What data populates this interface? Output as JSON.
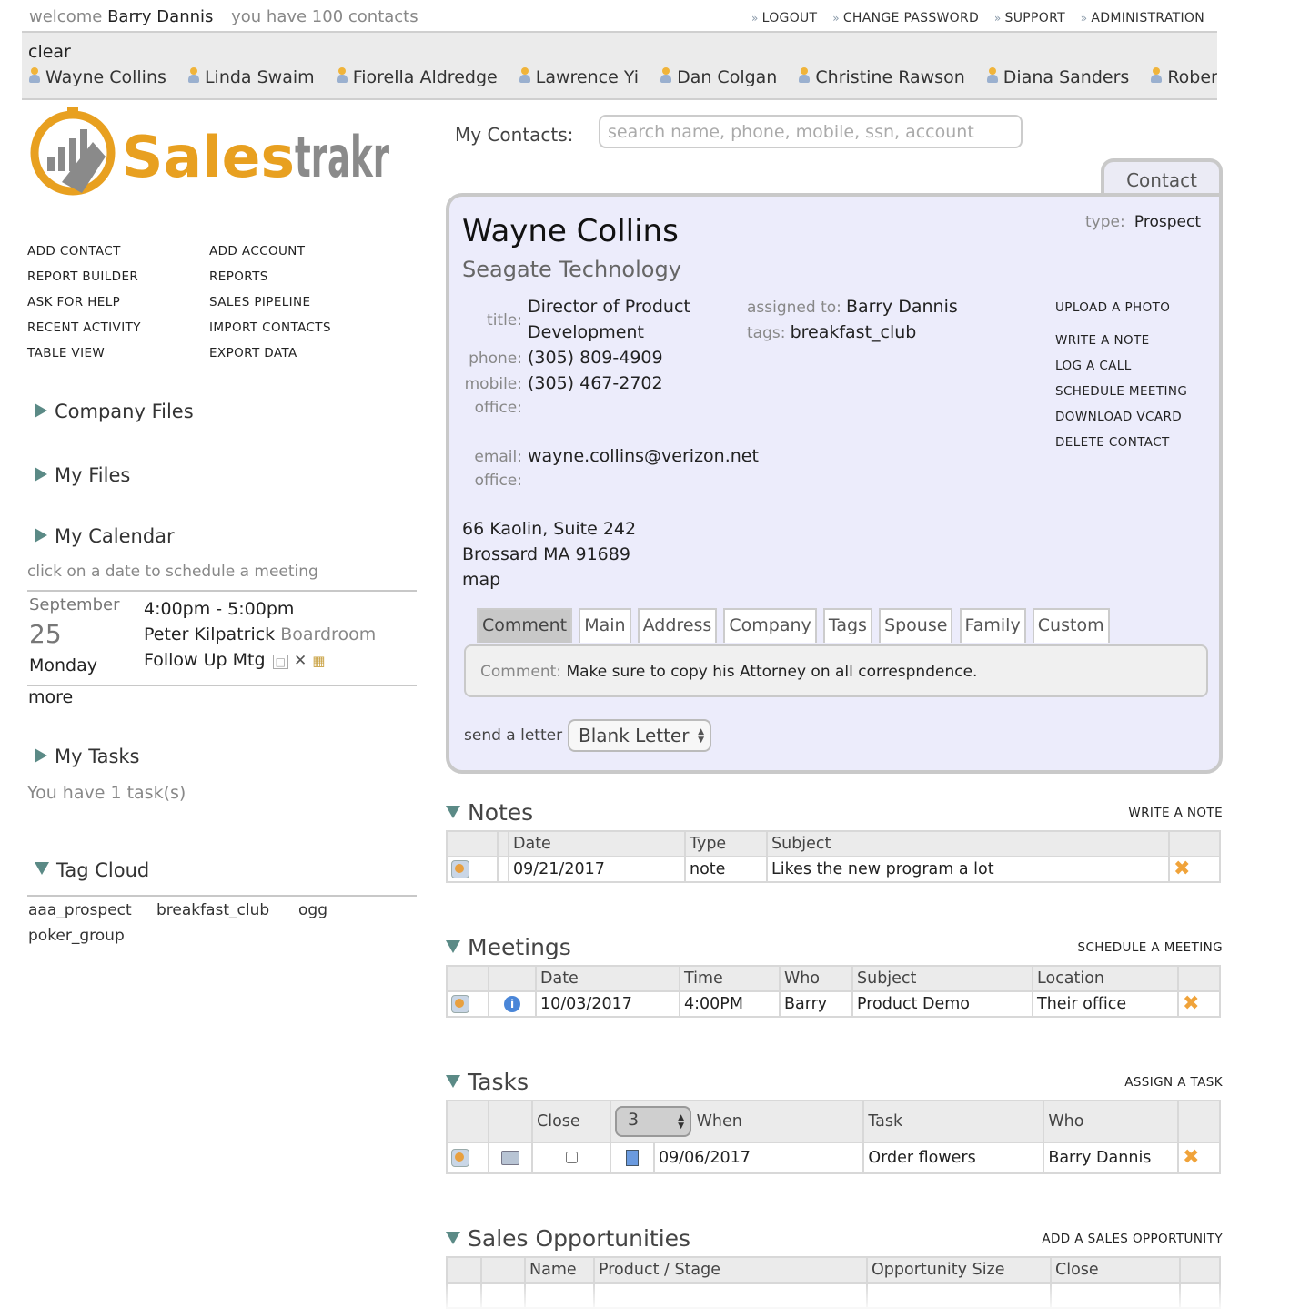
{
  "header": {
    "welcome_prefix": "welcome",
    "user": "Barry Dannis",
    "contacts_text": "you have 100 contacts",
    "links": [
      "LOGOUT",
      "CHANGE PASSWORD",
      "SUPPORT",
      "ADMINISTRATION"
    ]
  },
  "recent": {
    "clear": "clear",
    "people": [
      "Wayne Collins",
      "Linda Swaim",
      "Fiorella Aldredge",
      "Lawrence Yi",
      "Dan Colgan",
      "Christine Rawson",
      "Diana Sanders",
      "Robert"
    ]
  },
  "logo": {
    "text": "Salestrakr",
    "color": "#e8a020"
  },
  "menu": {
    "left": [
      "ADD CONTACT",
      "REPORT BUILDER",
      "ASK FOR HELP",
      "RECENT ACTIVITY",
      "TABLE VIEW"
    ],
    "right": [
      "ADD ACCOUNT",
      "REPORTS",
      "SALES PIPELINE",
      "IMPORT CONTACTS",
      "EXPORT DATA"
    ]
  },
  "sidebar": {
    "company_files": "Company Files",
    "my_files": "My Files",
    "my_calendar": "My Calendar",
    "calendar_hint": "click on a date to schedule a meeting",
    "calendar": {
      "month": "September",
      "day": "25",
      "weekday": "Monday",
      "time": "4:00pm - 5:00pm",
      "person": "Peter Kilpatrick",
      "location": "Boardroom",
      "event": "Follow Up Mtg"
    },
    "more": "more",
    "my_tasks": "My Tasks",
    "tasks_text": "You have 1 task(s)",
    "tag_cloud": "Tag Cloud",
    "tags": [
      "aaa_prospect",
      "breakfast_club",
      "ogg",
      "poker_group"
    ]
  },
  "search": {
    "label": "My Contacts:",
    "placeholder": "search name, phone, mobile, ssn, account"
  },
  "contact": {
    "tab": "Contact",
    "name": "Wayne Collins",
    "company": "Seagate Technology",
    "type_label": "type:",
    "type": "Prospect",
    "title_label": "title:",
    "title_line1": "Director of Product",
    "title_line2": "Development",
    "phone_label": "phone:",
    "phone": "(305) 809-4909",
    "mobile_label": "mobile:",
    "mobile": "(305) 467-2702",
    "office_label": "office:",
    "email_label": "email:",
    "email": "wayne.collins@verizon.net",
    "office2_label": "office:",
    "assigned_label": "assigned to:",
    "assigned": "Barry Dannis",
    "tags_label": "tags:",
    "tags": "breakfast_club",
    "address1": "66 Kaolin, Suite 242",
    "address2": "Brossard MA 91689",
    "map": "map",
    "actions": [
      "UPLOAD A PHOTO",
      "WRITE A NOTE",
      "LOG A CALL",
      "SCHEDULE MEETING",
      "DOWNLOAD VCARD",
      "DELETE CONTACT"
    ],
    "tabs": [
      "Comment",
      "Main",
      "Address",
      "Company",
      "Tags",
      "Spouse",
      "Family",
      "Custom"
    ],
    "comment_label": "Comment:",
    "comment": "Make sure to copy his Attorney on all correspndence.",
    "send_letter": "send a letter",
    "letter_select": "Blank Letter"
  },
  "notes": {
    "title": "Notes",
    "action": "WRITE A NOTE",
    "headers": [
      "Date",
      "Type",
      "Subject"
    ],
    "rows": [
      [
        "09/21/2017",
        "note",
        "Likes the new program a lot"
      ]
    ]
  },
  "meetings": {
    "title": "Meetings",
    "action": "SCHEDULE A MEETING",
    "headers": [
      "Date",
      "Time",
      "Who",
      "Subject",
      "Location"
    ],
    "rows": [
      [
        "10/03/2017",
        "4:00PM",
        "Barry",
        "Product Demo",
        "Their office"
      ]
    ]
  },
  "tasks": {
    "title": "Tasks",
    "action": "ASSIGN A TASK",
    "headers": [
      "Close",
      "When",
      "Task",
      "Who"
    ],
    "stepper": "3",
    "rows": [
      [
        "09/06/2017",
        "Order flowers",
        "Barry Dannis"
      ]
    ]
  },
  "opportunities": {
    "title": "Sales Opportunities",
    "action": "ADD A SALES OPPORTUNITY",
    "headers": [
      "Name",
      "Product / Stage",
      "Opportunity Size",
      "Close"
    ]
  }
}
